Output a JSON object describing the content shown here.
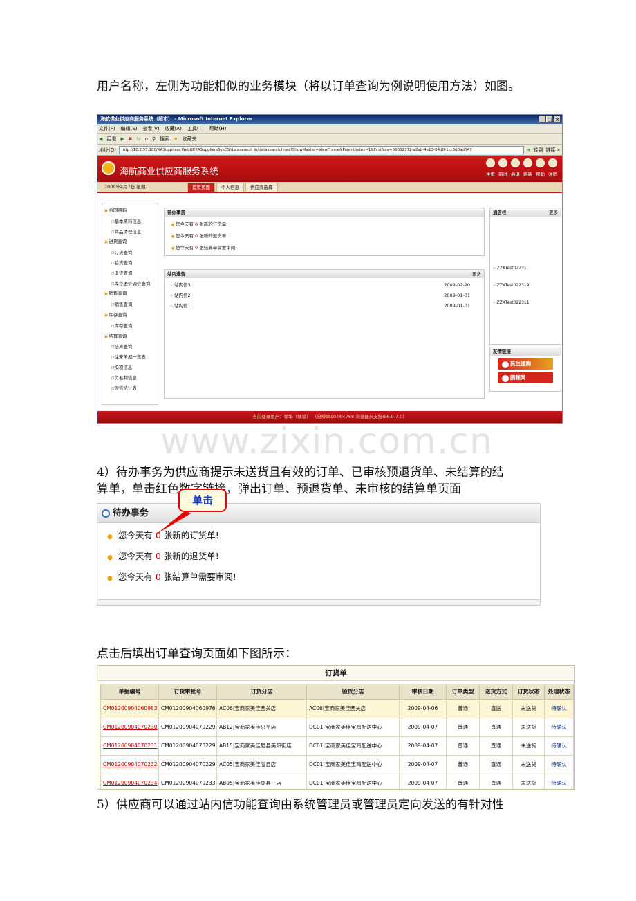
{
  "paragraphs": {
    "p1": "用户名称，左侧为功能相似的业务模块（将以订单查询为例说明使用方法）如图。",
    "p2_line1": "4）待办事务为供应商提示未送货且有效的订单、已审核预退货单、未结算的结",
    "p2_line2": "算单，单击红色数字链接，弹出订单、预退货单、未审核的结算单页面",
    "p3": "点击后填出订单查询页面如下图所示：",
    "p4": "5）供应商可以通过站内信功能查询由系统管理员或管理员定向发送的有针对性"
  },
  "watermark": "www.zixin.com.cn",
  "ie": {
    "title": "海航供业供应商服务系统（超市） - Microsoft Internet Explorer",
    "menu": [
      "文件(F)",
      "编辑(E)",
      "查看(V)",
      "收藏(A)",
      "工具(T)",
      "帮助(H)"
    ],
    "toolbar": [
      "后退",
      "搜索",
      "收藏夹"
    ],
    "address_label": "地址(D)",
    "url": "http://10.2.57.180/XASuppliers.WebUI/XASuppliersSysCS/datasearch_in/datasearch.hnas?ShowMaster=ViewFrame&ParentIndex=1&FirstNav=66652372-a2ab-4e13-84d0-1cc6d0adff47",
    "go": "转到",
    "links": "链接 »"
  },
  "app": {
    "name": "海航商业供应商服务系统",
    "icons": [
      "主页",
      "前进",
      "后退",
      "刷新",
      "帮助",
      "注销"
    ],
    "date": "2009年4月7日 星期二",
    "tabs": [
      "首页页面",
      "个人信息",
      "供应商选择"
    ],
    "side": [
      {
        "label": "合同资料",
        "level": 1
      },
      {
        "label": "基本资料信息",
        "level": 2
      },
      {
        "label": "商品清理信息",
        "level": 2
      },
      {
        "label": "进货查询",
        "level": 1
      },
      {
        "label": "订货查询",
        "level": 2
      },
      {
        "label": "验货查询",
        "level": 2
      },
      {
        "label": "退货查询",
        "level": 2
      },
      {
        "label": "库存进价调价查询",
        "level": 2
      },
      {
        "label": "销售查询",
        "level": 1
      },
      {
        "label": "销售查询",
        "level": 2
      },
      {
        "label": "库存查询",
        "level": 1
      },
      {
        "label": "库存查询",
        "level": 2
      },
      {
        "label": "结算查询",
        "level": 1
      },
      {
        "label": "结算查询",
        "level": 2
      },
      {
        "label": "往来单据一览表",
        "level": 2
      },
      {
        "label": "扣项信息",
        "level": 2
      },
      {
        "label": "负毛利信息",
        "level": 2
      },
      {
        "label": "短信统计表",
        "level": 2
      }
    ],
    "todo": {
      "title": "待办事务",
      "rows": [
        {
          "pre": "您今天有",
          "num": "0",
          "post": "张新的订货单!"
        },
        {
          "pre": "您今天有",
          "num": "0",
          "post": "张新的退货单!"
        },
        {
          "pre": "您今天有",
          "num": "0",
          "post": "张结算单需要审阅!"
        }
      ]
    },
    "news": {
      "title": "站内通告",
      "more": "更多",
      "rows": [
        {
          "name": "站内信3",
          "date": "2009-02-20"
        },
        {
          "name": "站内信2",
          "date": "2009-01-01"
        },
        {
          "name": "站内信1",
          "date": "2009-01-01"
        }
      ]
    },
    "notice": {
      "title": "通告栏",
      "more": "更多",
      "rows": [
        "ZZXTest02231",
        "ZZXTest022319",
        "ZZXTest022311"
      ]
    },
    "links": {
      "title": "友情链接",
      "items": [
        "民生速购",
        "鹏程网"
      ]
    },
    "footer": "当前登录用户：徐华（联营）   （分辨率1024×768 浏览器只支持IE6.0-7.0）"
  },
  "zoom": {
    "title": "待办事务",
    "rows": [
      {
        "pre": "您今天有",
        "num": "0",
        "post": "张新的订货单!"
      },
      {
        "pre": "您今天有",
        "num": "0",
        "post": "张新的退货单!"
      },
      {
        "pre": "您今天有",
        "num": "0",
        "post": "张结算单需要审阅!"
      }
    ],
    "callout": "单击"
  },
  "orders": {
    "title": "订货单",
    "headers": [
      "单据编号",
      "订货审批号",
      "订货分店",
      "验货分店",
      "审核日期",
      "订单类型",
      "送货方式",
      "订货状态",
      "处理状态"
    ],
    "rows": [
      [
        "CM01200904060983",
        "CM01200904060976",
        "AC06|宝商家美佳西关店",
        "AC06|宝商家美佳西关店",
        "2009-04-06",
        "普通",
        "直送",
        "未送货",
        "待确认"
      ],
      [
        "CM01200904070230",
        "CM01200904070229",
        "AB12|宝商家美佳兴平店",
        "DC01|宝商家美佳宝鸡配送中心",
        "2009-04-07",
        "普通",
        "直通",
        "未送货",
        "待确认"
      ],
      [
        "CM01200904070231",
        "CM01200904070229",
        "AB15|宝商家美佳眉县美阳街店",
        "DC01|宝商家美佳宝鸡配送中心",
        "2009-04-07",
        "普通",
        "直通",
        "未送货",
        "待确认"
      ],
      [
        "CM01200904070232",
        "CM01200904070229",
        "AC05|宝商家美佳陇县店",
        "DC01|宝商家美佳宝鸡配送中心",
        "2009-04-07",
        "普通",
        "直通",
        "未送货",
        "待确认"
      ],
      [
        "CM01200904070234",
        "CM01200904070233",
        "AB05|宝商家美佳凤县一店",
        "DC01|宝商家美佳宝鸡配送中心",
        "2009-04-07",
        "普通",
        "直通",
        "未送货",
        "待确认"
      ]
    ]
  }
}
